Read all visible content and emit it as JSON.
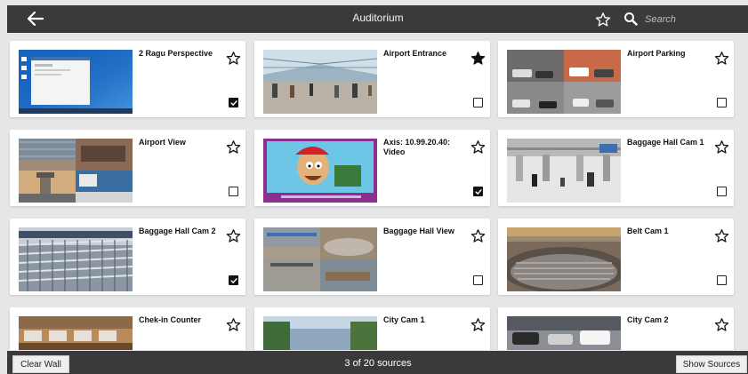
{
  "header": {
    "title": "Auditorium",
    "search_placeholder": "Search"
  },
  "sources": [
    {
      "name": "2 Ragu Perspective",
      "favorite": false,
      "selected": true,
      "thumb": "desktop"
    },
    {
      "name": "Airport Entrance",
      "favorite": true,
      "selected": false,
      "thumb": "hall"
    },
    {
      "name": "Airport Parking",
      "favorite": false,
      "selected": false,
      "thumb": "parking"
    },
    {
      "name": "Airport View",
      "favorite": false,
      "selected": false,
      "thumb": "airportview"
    },
    {
      "name": "Axis: 10.99.20.40: Video",
      "favorite": false,
      "selected": true,
      "thumb": "cartoon"
    },
    {
      "name": "Baggage Hall Cam 1",
      "favorite": false,
      "selected": false,
      "thumb": "baggage1"
    },
    {
      "name": "Baggage Hall Cam 2",
      "favorite": false,
      "selected": true,
      "thumb": "carts"
    },
    {
      "name": "Baggage Hall View",
      "favorite": false,
      "selected": false,
      "thumb": "hallview"
    },
    {
      "name": "Belt Cam 1",
      "favorite": false,
      "selected": false,
      "thumb": "belt"
    },
    {
      "name": "Chek-in Counter",
      "favorite": false,
      "selected": false,
      "thumb": "counter"
    },
    {
      "name": "City Cam 1",
      "favorite": false,
      "selected": false,
      "thumb": "city1"
    },
    {
      "name": "City Cam 2",
      "favorite": false,
      "selected": false,
      "thumb": "city2"
    }
  ],
  "footer": {
    "clear_label": "Clear Wall",
    "count_text": "3 of 20 sources",
    "show_label": "Show Sources"
  },
  "colors": {
    "bar": "#3a3a3a",
    "background": "#e6e6e6",
    "card": "#ffffff"
  }
}
